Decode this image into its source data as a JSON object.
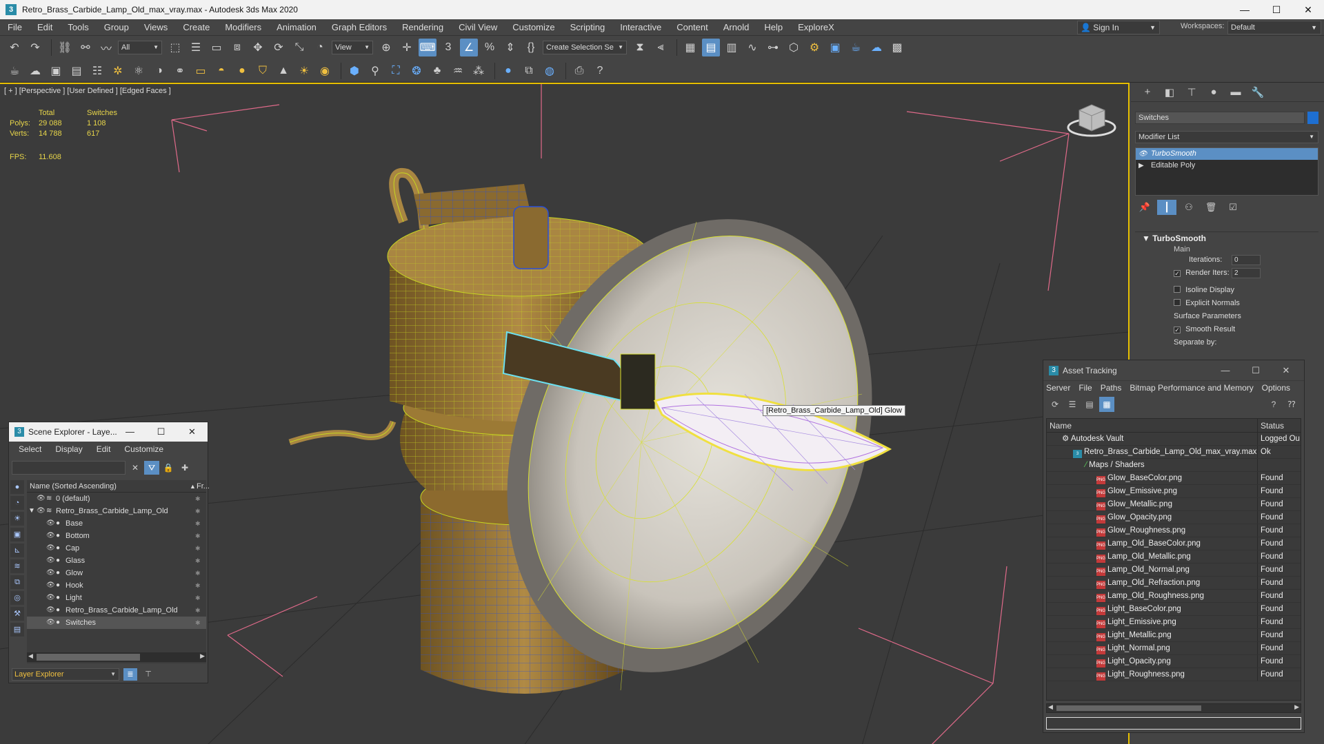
{
  "window": {
    "title": "Retro_Brass_Carbide_Lamp_Old_max_vray.max - Autodesk 3ds Max 2020",
    "app_icon": "3",
    "minimize": "—",
    "maximize": "☐",
    "close": "✕"
  },
  "menu": {
    "items": [
      "File",
      "Edit",
      "Tools",
      "Group",
      "Views",
      "Create",
      "Modifiers",
      "Animation",
      "Graph Editors",
      "Rendering",
      "Civil View",
      "Customize",
      "Scripting",
      "Interactive",
      "Content",
      "Arnold",
      "Help",
      "ExploreX"
    ],
    "signin": "Sign In",
    "workspaces_label": "Workspaces:",
    "workspaces_value": "Default"
  },
  "toolbar": {
    "filter_value": "All",
    "refcoord_value": "View",
    "selection_set_placeholder": "Create Selection Se",
    "snap_label": "3"
  },
  "viewport": {
    "label": "[ + ] [Perspective ] [User Defined ] [Edged Faces ]",
    "stats": {
      "header_total": "Total",
      "header_selected": "Switches",
      "polys_label": "Polys:",
      "polys_total": "29 088",
      "polys_selected": "1 108",
      "verts_label": "Verts:",
      "verts_total": "14 788",
      "verts_selected": "617",
      "fps_label": "FPS:",
      "fps_value": "11.608"
    },
    "tooltip": "[Retro_Brass_Carbide_Lamp_Old] Glow"
  },
  "command_panel": {
    "object_name": "Switches",
    "object_color": "#1e6fd1",
    "modifier_list_label": "Modifier List",
    "stack": [
      {
        "label": "TurboSmooth",
        "selected": true
      },
      {
        "label": "Editable Poly",
        "selected": false
      }
    ],
    "rollout": {
      "title": "TurboSmooth",
      "main_label": "Main",
      "iterations_label": "Iterations:",
      "iterations_value": "0",
      "render_iters_label": "Render Iters:",
      "render_iters_value": "2",
      "isoline_label": "Isoline Display",
      "explicit_normals_label": "Explicit Normals",
      "surface_params_label": "Surface Parameters",
      "smooth_result_label": "Smooth Result",
      "separate_by_label": "Separate by:"
    }
  },
  "asset_tracking": {
    "title": "Asset Tracking",
    "menu": [
      "Server",
      "File",
      "Paths",
      "Bitmap Performance and Memory"
    ],
    "options": "Options",
    "col_name": "Name",
    "col_status": "Status",
    "vault": {
      "name": "Autodesk Vault",
      "status": "Logged Ou"
    },
    "scene_file": {
      "name": "Retro_Brass_Carbide_Lamp_Old_max_vray.max",
      "status": "Ok"
    },
    "maps_folder": "Maps / Shaders",
    "files": [
      {
        "name": "Glow_BaseColor.png",
        "status": "Found"
      },
      {
        "name": "Glow_Emissive.png",
        "status": "Found"
      },
      {
        "name": "Glow_Metallic.png",
        "status": "Found"
      },
      {
        "name": "Glow_Opacity.png",
        "status": "Found"
      },
      {
        "name": "Glow_Roughness.png",
        "status": "Found"
      },
      {
        "name": "Lamp_Old_BaseColor.png",
        "status": "Found"
      },
      {
        "name": "Lamp_Old_Metallic.png",
        "status": "Found"
      },
      {
        "name": "Lamp_Old_Normal.png",
        "status": "Found"
      },
      {
        "name": "Lamp_Old_Refraction.png",
        "status": "Found"
      },
      {
        "name": "Lamp_Old_Roughness.png",
        "status": "Found"
      },
      {
        "name": "Light_BaseColor.png",
        "status": "Found"
      },
      {
        "name": "Light_Emissive.png",
        "status": "Found"
      },
      {
        "name": "Light_Metallic.png",
        "status": "Found"
      },
      {
        "name": "Light_Normal.png",
        "status": "Found"
      },
      {
        "name": "Light_Opacity.png",
        "status": "Found"
      },
      {
        "name": "Light_Roughness.png",
        "status": "Found"
      }
    ],
    "png_badge": "PNG"
  },
  "scene_explorer": {
    "title": "Scene Explorer - Laye...",
    "menu": [
      "Select",
      "Display",
      "Edit",
      "Customize"
    ],
    "col_name": "Name (Sorted Ascending)",
    "col_frozen": "Fr...",
    "rows": [
      {
        "label": "0 (default)",
        "level": 1
      },
      {
        "label": "Retro_Brass_Carbide_Lamp_Old",
        "level": 1
      },
      {
        "label": "Base",
        "level": 2
      },
      {
        "label": "Bottom",
        "level": 2
      },
      {
        "label": "Cap",
        "level": 2
      },
      {
        "label": "Glass",
        "level": 2
      },
      {
        "label": "Glow",
        "level": 2
      },
      {
        "label": "Hook",
        "level": 2
      },
      {
        "label": "Light",
        "level": 2
      },
      {
        "label": "Retro_Brass_Carbide_Lamp_Old",
        "level": 2
      },
      {
        "label": "Switches",
        "level": 2
      }
    ],
    "layer_dropdown": "Layer Explorer"
  }
}
